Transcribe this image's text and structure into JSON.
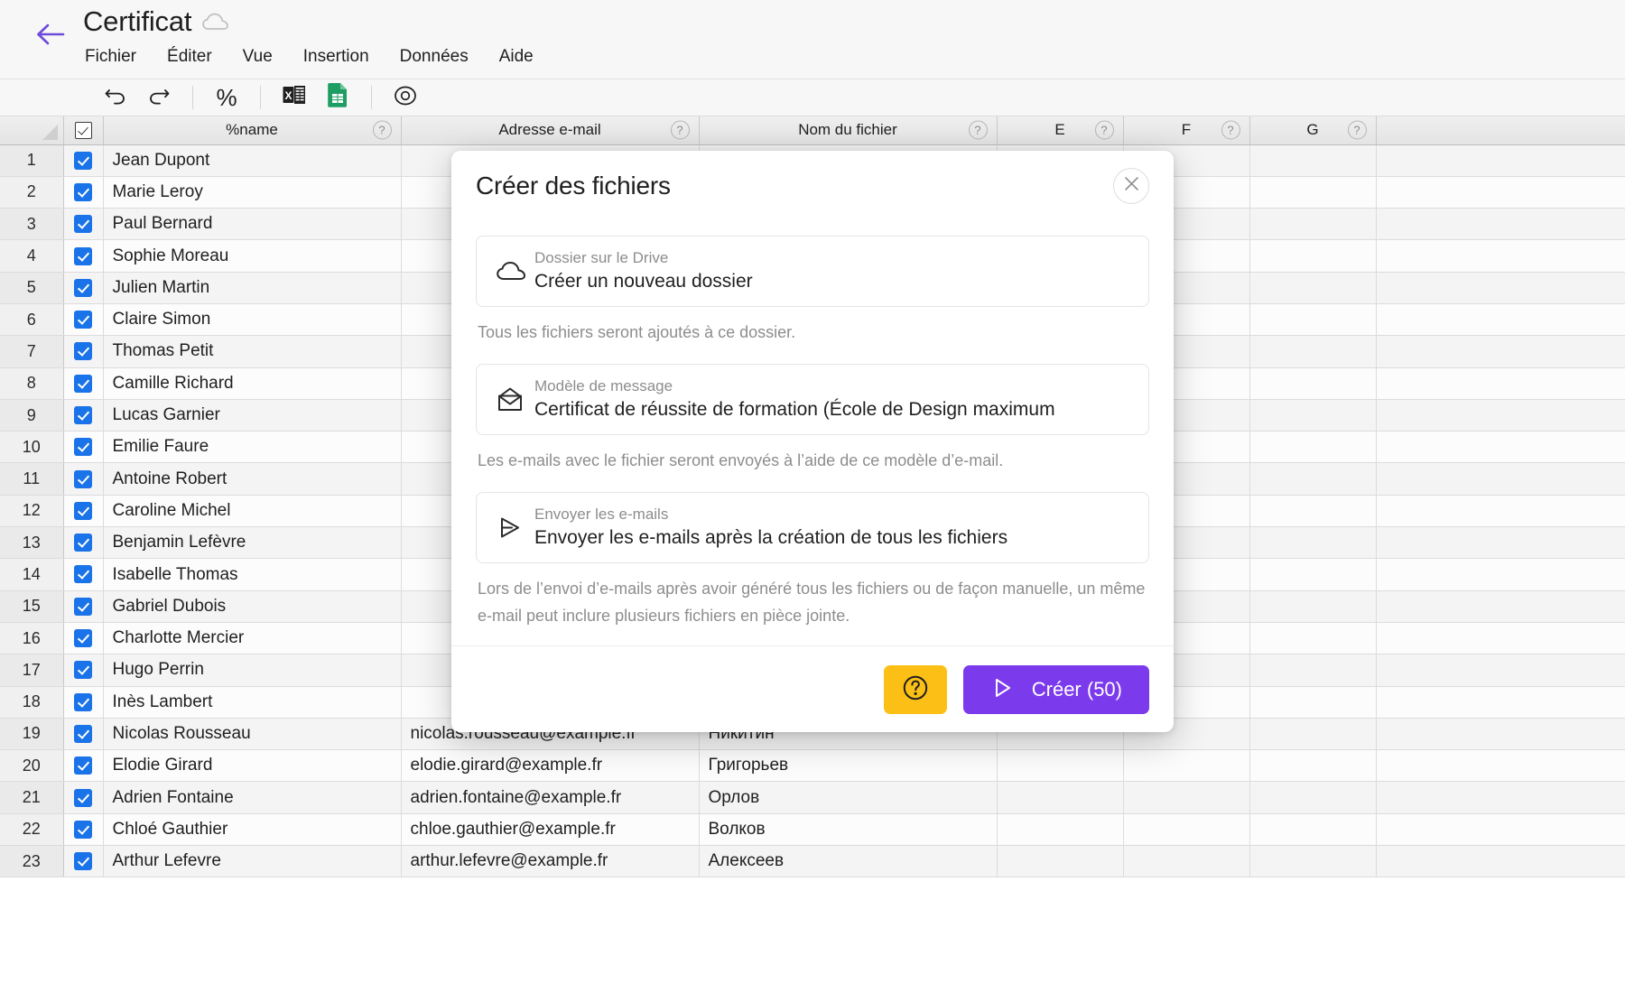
{
  "header": {
    "back_icon": "arrow-left-icon",
    "doc_title": "Certificat",
    "cloud_icon": "cloud-icon",
    "menu": [
      {
        "label": "Fichier"
      },
      {
        "label": "Éditer"
      },
      {
        "label": "Vue"
      },
      {
        "label": "Insertion"
      },
      {
        "label": "Données"
      },
      {
        "label": "Aide"
      }
    ]
  },
  "toolbar": {
    "undo_icon": "undo-icon",
    "redo_icon": "redo-icon",
    "percent_label": "%",
    "excel_icon": "excel-export-icon",
    "sheets_icon": "google-sheets-icon",
    "preview_icon": "eye-preview-icon"
  },
  "sheet": {
    "columns": [
      {
        "key": "corner",
        "label": "",
        "help": ""
      },
      {
        "key": "check",
        "label": "",
        "help": ""
      },
      {
        "key": "name",
        "label": "%name",
        "help": "?"
      },
      {
        "key": "email",
        "label": "Adresse e-mail",
        "help": "?"
      },
      {
        "key": "file",
        "label": "Nom du fichier",
        "help": "?"
      },
      {
        "key": "e",
        "label": "E",
        "help": "?"
      },
      {
        "key": "f",
        "label": "F",
        "help": "?"
      },
      {
        "key": "g",
        "label": "G",
        "help": "?"
      },
      {
        "key": "h",
        "label": "",
        "help": ""
      }
    ],
    "rows": [
      {
        "n": "1",
        "checked": true,
        "name": "Jean Dupont",
        "email": "",
        "file": ""
      },
      {
        "n": "2",
        "checked": true,
        "name": "Marie Leroy",
        "email": "",
        "file": ""
      },
      {
        "n": "3",
        "checked": true,
        "name": "Paul Bernard",
        "email": "",
        "file": ""
      },
      {
        "n": "4",
        "checked": true,
        "name": "Sophie Moreau",
        "email": "",
        "file": ""
      },
      {
        "n": "5",
        "checked": true,
        "name": "Julien Martin",
        "email": "",
        "file": ""
      },
      {
        "n": "6",
        "checked": true,
        "name": "Claire Simon",
        "email": "",
        "file": ""
      },
      {
        "n": "7",
        "checked": true,
        "name": "Thomas Petit",
        "email": "",
        "file": ""
      },
      {
        "n": "8",
        "checked": true,
        "name": "Camille Richard",
        "email": "",
        "file": ""
      },
      {
        "n": "9",
        "checked": true,
        "name": "Lucas Garnier",
        "email": "",
        "file": ""
      },
      {
        "n": "10",
        "checked": true,
        "name": "Emilie Faure",
        "email": "",
        "file": ""
      },
      {
        "n": "11",
        "checked": true,
        "name": "Antoine Robert",
        "email": "",
        "file": ""
      },
      {
        "n": "12",
        "checked": true,
        "name": "Caroline Michel",
        "email": "",
        "file": ""
      },
      {
        "n": "13",
        "checked": true,
        "name": "Benjamin Lefèvre",
        "email": "",
        "file": ""
      },
      {
        "n": "14",
        "checked": true,
        "name": "Isabelle Thomas",
        "email": "",
        "file": ""
      },
      {
        "n": "15",
        "checked": true,
        "name": "Gabriel Dubois",
        "email": "",
        "file": ""
      },
      {
        "n": "16",
        "checked": true,
        "name": "Charlotte Mercier",
        "email": "",
        "file": ""
      },
      {
        "n": "17",
        "checked": true,
        "name": "Hugo Perrin",
        "email": "",
        "file": ""
      },
      {
        "n": "18",
        "checked": true,
        "name": "Inès Lambert",
        "email": "",
        "file": ""
      },
      {
        "n": "19",
        "checked": true,
        "name": "Nicolas Rousseau",
        "email": "nicolas.rousseau@example.fr",
        "file": "Никитин"
      },
      {
        "n": "20",
        "checked": true,
        "name": "Elodie Girard",
        "email": "elodie.girard@example.fr",
        "file": "Григорьев"
      },
      {
        "n": "21",
        "checked": true,
        "name": "Adrien Fontaine",
        "email": "adrien.fontaine@example.fr",
        "file": "Орлов"
      },
      {
        "n": "22",
        "checked": true,
        "name": "Chloé Gauthier",
        "email": "chloe.gauthier@example.fr",
        "file": "Волков"
      },
      {
        "n": "23",
        "checked": true,
        "name": "Arthur Lefevre",
        "email": "arthur.lefevre@example.fr",
        "file": "Алексеев"
      }
    ]
  },
  "modal": {
    "title": "Créer des fichiers",
    "close_icon": "close-icon",
    "fields": [
      {
        "icon": "cloud-icon",
        "label": "Dossier sur le Drive",
        "value": "Créer un nouveau dossier",
        "helper": "Tous les fichiers seront ajoutés à ce dossier."
      },
      {
        "icon": "envelope-icon",
        "label": "Modèle de message",
        "value": "Certificat de réussite de formation (École de Design maximum",
        "helper": "Les e-mails avec le fichier seront envoyés à l’aide de ce modèle d’e-mail."
      },
      {
        "icon": "send-triangle-icon",
        "label": "Envoyer les e-mails",
        "value": "Envoyer les e-mails après la création de tous les fichiers",
        "helper": "Lors de l’envoi d’e-mails après avoir généré tous les fichiers ou de façon manuelle, un même e-mail peut inclure plusieurs fichiers en pièce jointe."
      }
    ],
    "footer": {
      "help_icon": "question-circle-icon",
      "create_icon": "play-triangle-icon",
      "create_label": "Créer (50)",
      "help_color": "#fbbf15",
      "create_color": "#7c3aed"
    }
  }
}
